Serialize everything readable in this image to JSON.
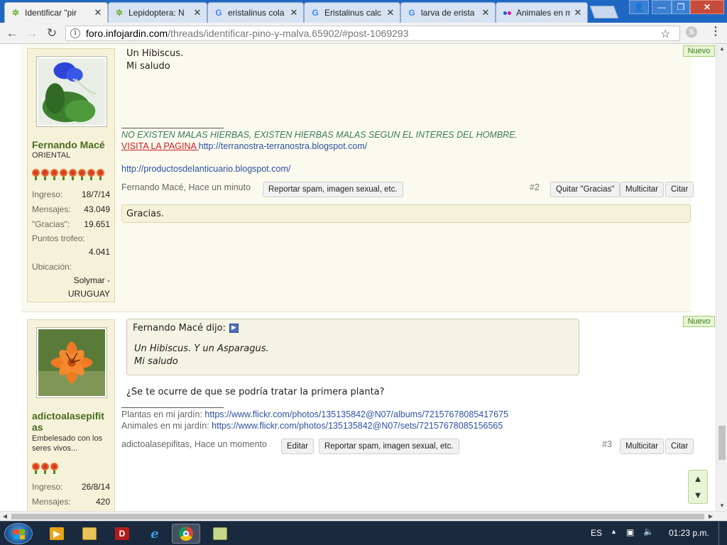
{
  "browser": {
    "tabs": [
      {
        "title": "Identificar \"pir",
        "favicon": "infojardin-leaf-icon",
        "active": true
      },
      {
        "title": "Lepidoptera: N",
        "favicon": "infojardin-leaf-icon",
        "active": false
      },
      {
        "title": "eristalinus cola",
        "favicon": "google-g-icon",
        "active": false
      },
      {
        "title": "Eristalinus calc",
        "favicon": "google-g-icon",
        "active": false
      },
      {
        "title": "larva de erista",
        "favicon": "google-g-icon",
        "active": false
      },
      {
        "title": "Animales en m",
        "favicon": "flickr-dots-icon",
        "active": false
      }
    ],
    "url_host": "foro.infojardin.com",
    "url_path": "/threads/identificar-pino-y-malva.65902/#post-1069293"
  },
  "post2": {
    "body_lines": [
      "Un Hibiscus.",
      "Mi saludo"
    ],
    "badge": "Nuevo",
    "user": {
      "name": "Fernando Macé",
      "title": "ORIENTAL",
      "stats": [
        {
          "label": "Ingreso:",
          "value": "18/7/14"
        },
        {
          "label": "Mensajes:",
          "value": "43.049"
        },
        {
          "label": "\"Gracias\":",
          "value": "19.651"
        }
      ],
      "trophy_label": "Puntos trofeo:",
      "trophy_value": "4.041",
      "location_label": "Ubicación:",
      "location_line1": "Solymar -",
      "location_line2": "URUGUAY",
      "stars": 8
    },
    "signature": {
      "motto": "NO EXISTEN MALAS HIERBAS, EXISTEN HIERBAS MALAS SEGUN EL INTERES DEL HOMBRE.",
      "visit_label": "VISITA LA PAGINA ",
      "visit_link": "http://terranostra-terranostra.blogspot.com/",
      "second_link": "http://productosdelanticuario.blogspot.com/"
    },
    "meta": "Fernando Macé, Hace un minuto",
    "report_button": "Reportar spam, imagen sexual, etc.",
    "post_number": "#2",
    "unlike_button": "Quitar \"Gracias\"",
    "multiquote_button": "Multicitar",
    "quote_button": "Citar",
    "likes_text": "Gracias."
  },
  "post3": {
    "badge": "Nuevo",
    "quote": {
      "author": "Fernando Macé dijo:",
      "lines": [
        "Un Hibiscus. Y un Asparagus.",
        "Mi saludo"
      ]
    },
    "body": "¿Se te ocurre de que se podría tratar la primera planta?",
    "user": {
      "name_line1": "adictoalasepifit",
      "name_line2": "as",
      "title_line1": "Embelesado con los",
      "title_line2": "seres vivos...",
      "stars": 3,
      "stats": [
        {
          "label": "Ingreso:",
          "value": "26/8/14"
        },
        {
          "label": "Mensajes:",
          "value": "420"
        }
      ]
    },
    "signature": {
      "plants_label": "Plantas en mi jardín: ",
      "plants_link": "https://www.flickr.com/photos/135135842@N07/albums/72157678085417675",
      "animals_label": "Animales en mi jardín: ",
      "animals_link": "https://www.flickr.com/photos/135135842@N07/sets/72157678085156565"
    },
    "meta": "adictoalasepifitas, Hace un momento",
    "edit_button": "Editar",
    "report_button": "Reportar spam, imagen sexual, etc.",
    "post_number": "#3",
    "multiquote_button": "Multicitar",
    "quote_button": "Citar"
  },
  "taskbar": {
    "language": "ES",
    "clock": "01:23 p.m.",
    "apps": [
      "media-player-icon",
      "file-explorer-icon",
      "acrobat-icon",
      "internet-explorer-icon",
      "chrome-icon",
      "notepad-icon"
    ]
  }
}
